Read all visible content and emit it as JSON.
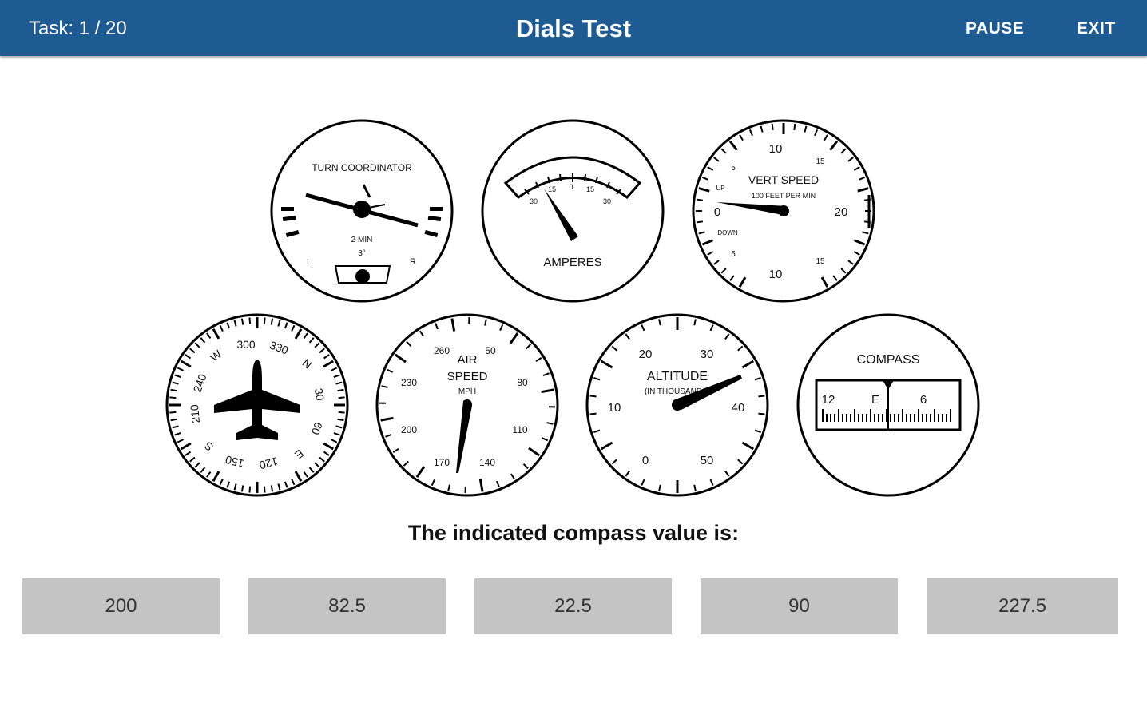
{
  "header": {
    "task_label": "Task: 1 / 20",
    "title": "Dials Test",
    "pause_label": "PAUSE",
    "exit_label": "EXIT",
    "bar_color": "#1f5b93"
  },
  "dials": {
    "turn_coordinator": {
      "title": "TURN COORDINATOR",
      "min_label": "2 MIN",
      "deg_label": "3°",
      "left_label": "L",
      "right_label": "R"
    },
    "amperes": {
      "title": "AMPERES",
      "scale": [
        "30",
        "15",
        "0",
        "15",
        "30"
      ]
    },
    "vert_speed": {
      "title": "VERT SPEED",
      "subtitle": "100 FEET PER MIN",
      "up_label": "UP",
      "down_label": "DOWN",
      "scale": [
        "10",
        "5",
        "15",
        "0",
        "20",
        "5",
        "15",
        "10"
      ]
    },
    "heading": {
      "scale": [
        "300",
        "330",
        "W",
        "N",
        "240",
        "30",
        "210",
        "60",
        "S",
        "E",
        "150",
        "120"
      ]
    },
    "airspeed": {
      "title_line1": "AIR",
      "title_line2": "SPEED",
      "unit": "MPH",
      "scale": [
        "260",
        "50",
        "230",
        "80",
        "200",
        "110",
        "170",
        "140"
      ]
    },
    "altitude": {
      "title": "ALTITUDE",
      "subtitle": "(IN THOUSANDS)",
      "scale": [
        "20",
        "30",
        "10",
        "40",
        "0",
        "50"
      ]
    },
    "compass": {
      "title": "COMPASS",
      "card_labels": [
        "12",
        "E",
        "6"
      ]
    }
  },
  "question": "The indicated compass value is:",
  "answers": [
    "200",
    "82.5",
    "22.5",
    "90",
    "227.5"
  ]
}
